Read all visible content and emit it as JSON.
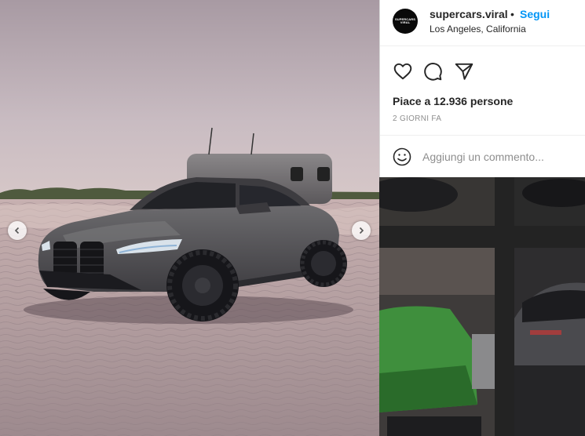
{
  "post": {
    "username": "supercars.viral",
    "separator": "•",
    "follow_label": "Segui",
    "location": "Los Angeles, California",
    "avatar_text_line1": "SUPERCARS",
    "avatar_text_line2": "VIRAL",
    "likes_text": "Piace a 12.936 persone",
    "timestamp": "2 GIORNI FA",
    "comment_placeholder": "Aggiungi un commento..."
  },
  "icons": {
    "like": "heart-icon",
    "comment": "speech-bubble-icon",
    "share": "paper-plane-icon",
    "emoji": "smiley-icon",
    "prev": "chevron-left-icon",
    "next": "chevron-right-icon"
  },
  "colors": {
    "follow": "#0095f6",
    "text": "#262626",
    "muted": "#8e8e8e"
  }
}
